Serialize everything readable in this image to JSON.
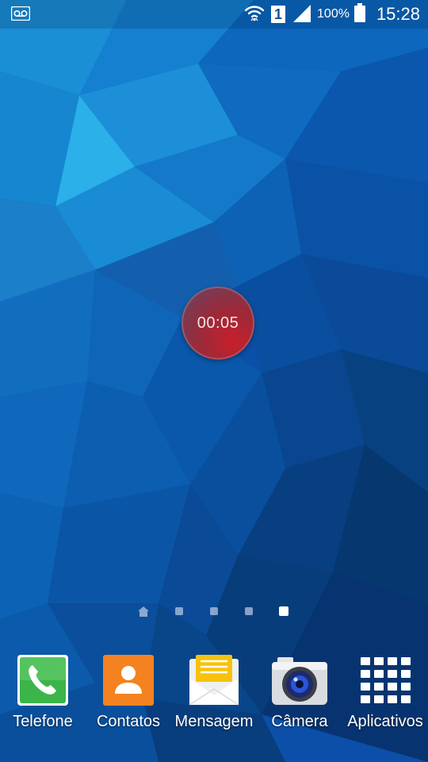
{
  "status_bar": {
    "left_icon": "voicemail-icon",
    "wifi_icon": "wifi-icon",
    "sim_slot": "1",
    "signal_icon": "signal-icon",
    "battery_percent": "100%",
    "battery_icon": "battery-icon",
    "time": "15:28"
  },
  "recording": {
    "timer": "00:05",
    "accent": "#c7202a"
  },
  "page_indicator": {
    "page_count": 5,
    "active_page": 5,
    "first_is_home": true
  },
  "dock": {
    "apps": [
      {
        "label": "Telefone",
        "icon": "phone-icon",
        "color": "#3bb54a"
      },
      {
        "label": "Contatos",
        "icon": "contacts-icon",
        "color": "#f58220"
      },
      {
        "label": "Mensagem",
        "icon": "message-icon",
        "color": "#f6c20e"
      },
      {
        "label": "Câmera",
        "icon": "camera-icon",
        "color": "#2a3f8f"
      },
      {
        "label": "Aplicativos",
        "icon": "apps-grid-icon",
        "color": "#ffffff"
      }
    ]
  }
}
